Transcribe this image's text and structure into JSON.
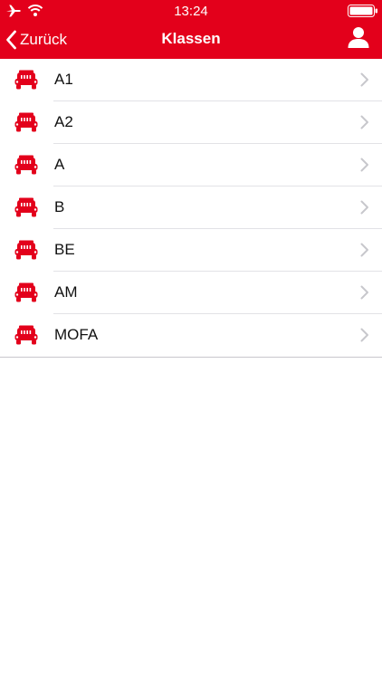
{
  "colors": {
    "brand": "#e3001b",
    "text": "#111111",
    "chevron": "#c7c7cc",
    "separator": "#e2e2e6"
  },
  "status_bar": {
    "time": "13:24",
    "icons": [
      "airplane-icon",
      "wifi-icon",
      "battery-icon"
    ]
  },
  "nav": {
    "back_label": "Zurück",
    "title": "Klassen",
    "right_icon": "person-icon"
  },
  "list": {
    "item_icon": "car-icon",
    "item_chevron": "chevron-right-icon",
    "items": [
      {
        "label": "A1"
      },
      {
        "label": "A2"
      },
      {
        "label": "A"
      },
      {
        "label": "B"
      },
      {
        "label": "BE"
      },
      {
        "label": "AM"
      },
      {
        "label": "MOFA"
      }
    ]
  }
}
